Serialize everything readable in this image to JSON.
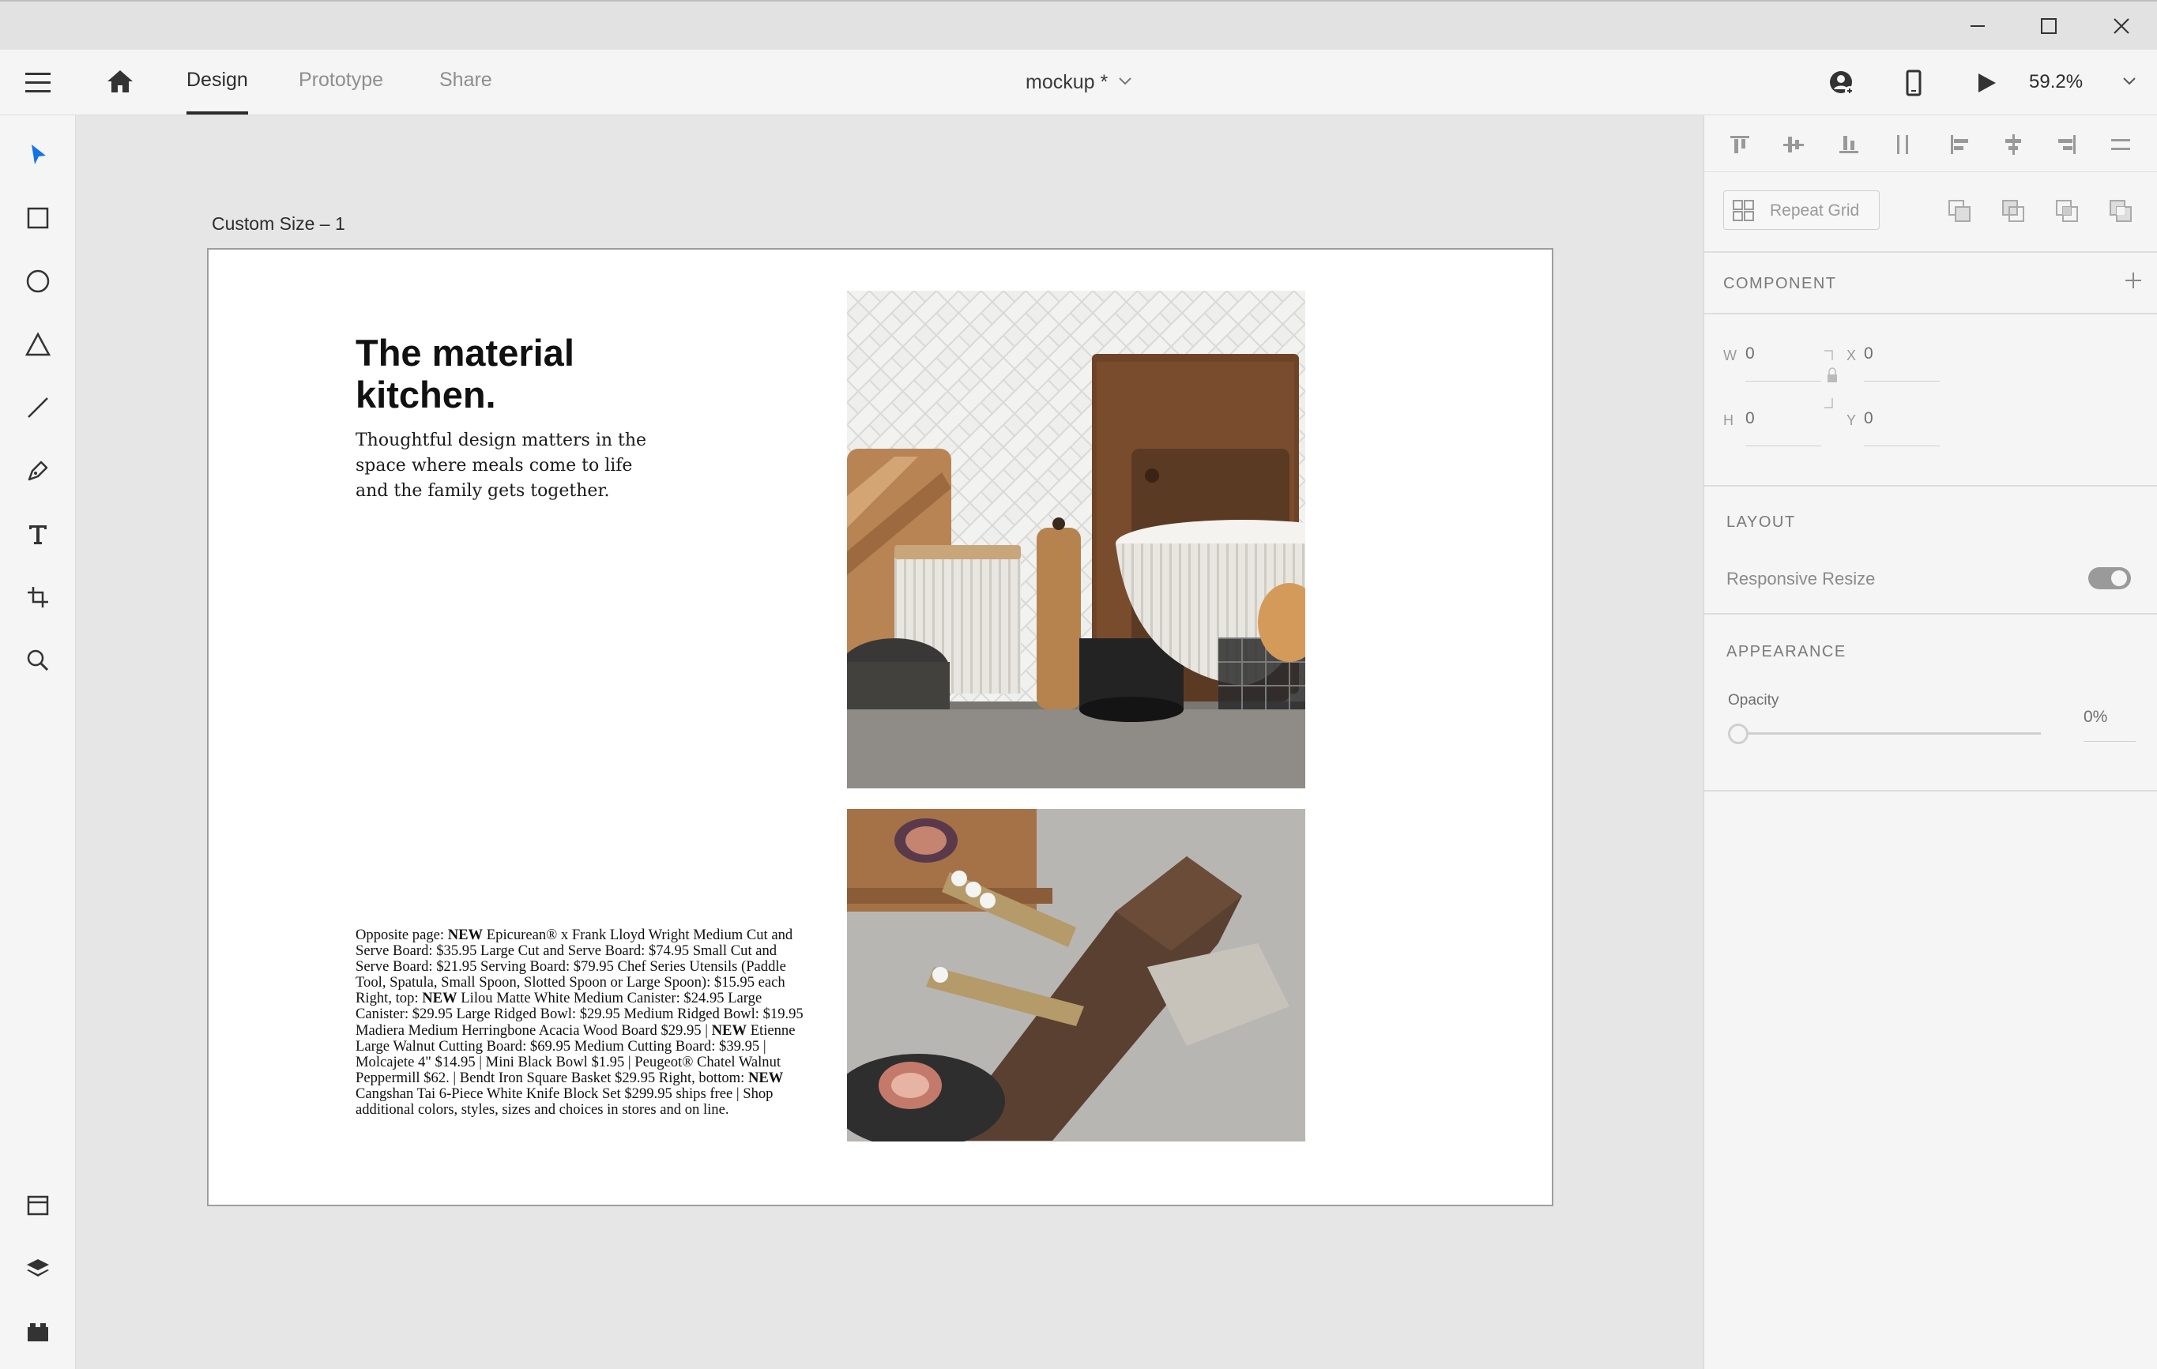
{
  "window": {
    "controls": [
      "minimize-icon",
      "maximize-icon",
      "close-icon"
    ]
  },
  "appbar": {
    "tabs": [
      {
        "label": "Design"
      },
      {
        "label": "Prototype"
      },
      {
        "label": "Share"
      }
    ],
    "active_tab": "Design",
    "document_title": "mockup *",
    "zoom": "59.2%",
    "icons": [
      "hamburger-menu-icon",
      "home-icon",
      "share-user-icon",
      "device-preview-icon",
      "play-icon"
    ]
  },
  "toolbar": {
    "tools": [
      "select-tool",
      "rectangle-tool",
      "ellipse-tool",
      "polygon-tool",
      "line-tool",
      "pen-tool",
      "text-tool",
      "artboard-tool",
      "zoom-tool"
    ],
    "bottom_tools": [
      "assets-panel",
      "layers-panel",
      "plugins-panel"
    ]
  },
  "canvas": {
    "artboard_name": "Custom Size – 1",
    "headline": "The material kitchen.",
    "subhead": "Thoughtful design matters in the space where meals come to life and the family gets together.",
    "caption": [
      {
        "t": "Opposite page: ",
        "b": false
      },
      {
        "t": "NEW",
        "b": true
      },
      {
        "t": " Epicurean® x Frank Lloyd Wright Medium Cut and Serve Board: $35.95 Large Cut and Serve Board: $74.95 Small Cut and Serve Board: $21.95 Serving Board: $79.95 Chef Series Utensils (Paddle Tool, Spatula, Small Spoon, Slotted Spoon or Large Spoon): $15.95 each Right, top: ",
        "b": false
      },
      {
        "t": "NEW",
        "b": true
      },
      {
        "t": " Lilou Matte White Medium Canister: $24.95 Large Canister: $29.95 Large Ridged Bowl: $29.95 Medium Ridged Bowl: $19.95 Madiera Medium Herringbone Acacia Wood Board $29.95 | ",
        "b": false
      },
      {
        "t": "NEW",
        "b": true
      },
      {
        "t": " Etienne Large Walnut Cutting Board: $69.95 Medium Cutting Board: $39.95 | Molcajete 4\" $14.95 |  Mini Black Bowl $1.95 | Peugeot® Chatel Walnut Peppermill $62. |  Bendt Iron Square Basket $29.95 Right, bottom: ",
        "b": false
      },
      {
        "t": "NEW",
        "b": true
      },
      {
        "t": " Cangshan Tai 6-Piece White Knife Block Set $299.95 ships free | Shop additional colors, styles, sizes and choices in stores and on line.",
        "b": false
      }
    ]
  },
  "panel": {
    "repeat_grid_label": "Repeat Grid",
    "component_title": "COMPONENT",
    "fields": {
      "w_label": "W",
      "w_value": "0",
      "h_label": "H",
      "h_value": "0",
      "x_label": "X",
      "x_value": "0",
      "y_label": "Y",
      "y_value": "0"
    },
    "layout_title": "LAYOUT",
    "responsive_resize_label": "Responsive Resize",
    "responsive_resize_on": true,
    "appearance_title": "APPEARANCE",
    "opacity_label": "Opacity",
    "opacity_value": "0%"
  }
}
